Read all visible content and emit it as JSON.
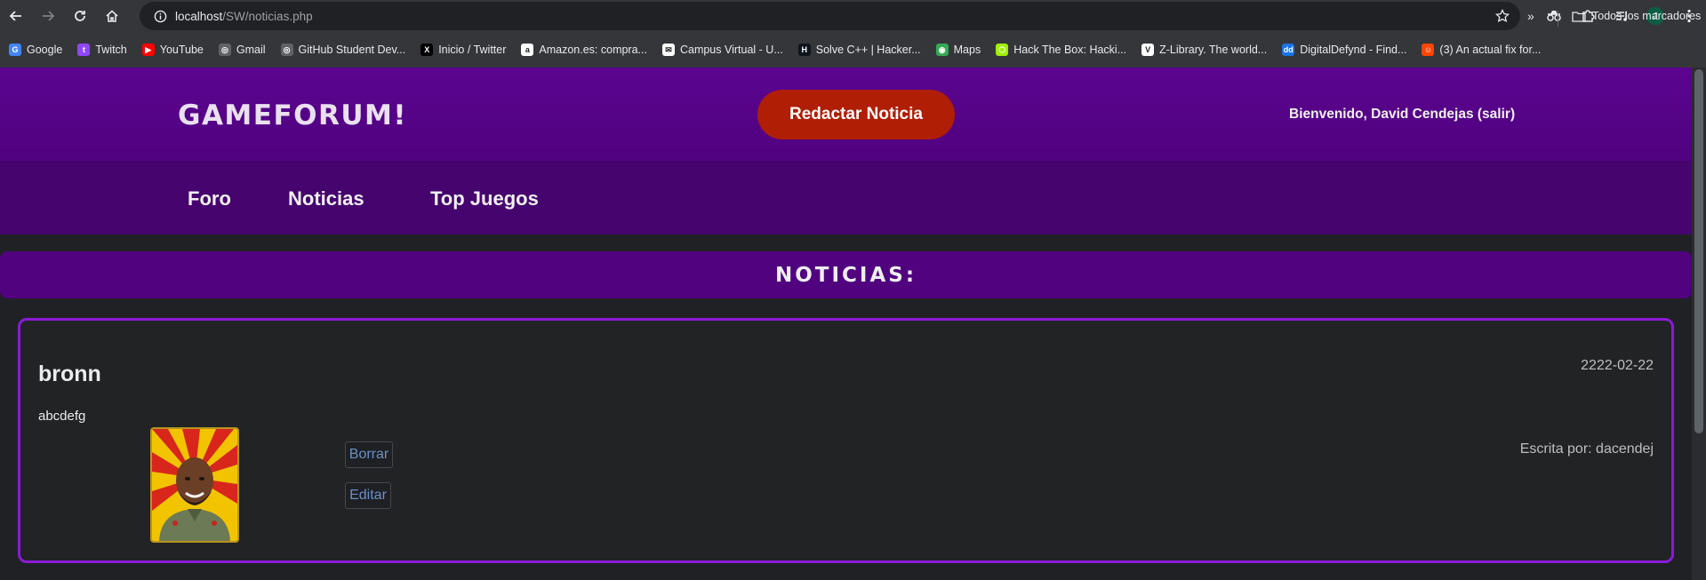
{
  "browser": {
    "url_host": "localhost",
    "url_path": "/SW/noticias.php",
    "avatar_letter": "J",
    "bookmarks": [
      {
        "label": "Google",
        "color": "#4285f4",
        "glyph": "G"
      },
      {
        "label": "Twitch",
        "color": "#9146ff",
        "glyph": "t"
      },
      {
        "label": "YouTube",
        "color": "#ff0000",
        "glyph": "▶"
      },
      {
        "label": "Gmail",
        "color": "#5f6368",
        "glyph": "◎"
      },
      {
        "label": "GitHub Student Dev...",
        "color": "#5f6368",
        "glyph": "◎"
      },
      {
        "label": "Inicio / Twitter",
        "color": "#000000",
        "glyph": "X"
      },
      {
        "label": "Amazon.es: compra...",
        "color": "#ffffff",
        "glyph": "a"
      },
      {
        "label": "Campus Virtual - U...",
        "color": "#ffffff",
        "glyph": "✉"
      },
      {
        "label": "Solve C++ | Hacker...",
        "color": "#0e141e",
        "glyph": "H"
      },
      {
        "label": "Maps",
        "color": "#34a853",
        "glyph": "◉"
      },
      {
        "label": "Hack The Box: Hacki...",
        "color": "#9fef00",
        "glyph": "⬡"
      },
      {
        "label": "Z-Library. The world...",
        "color": "#ffffff",
        "glyph": "V"
      },
      {
        "label": "DigitalDefynd - Find...",
        "color": "#1a73e8",
        "glyph": "dd"
      },
      {
        "label": "(3) An actual fix for...",
        "color": "#ff4500",
        "glyph": "☺"
      }
    ],
    "all_bookmarks_label": "Todos los marcadores"
  },
  "site": {
    "logo": "GAMEFORUM!",
    "write_button": "Redactar Noticia",
    "welcome": "Bienvenido, David Cendejas (salir)",
    "nav": [
      "Foro",
      "Noticias",
      "Top Juegos"
    ],
    "section_title": "NOTICIAS:"
  },
  "news": {
    "title": "bronn",
    "date": "2222-02-22",
    "body": "abcdefg",
    "delete_label": "Borrar",
    "edit_label": "Editar",
    "author": "Escrita por: dacendej"
  }
}
